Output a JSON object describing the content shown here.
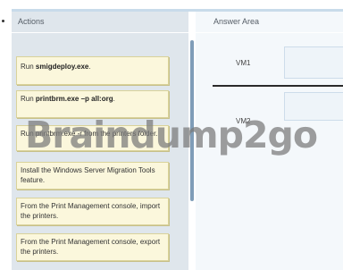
{
  "actions_panel": {
    "header": "Actions",
    "items": [
      {
        "prefix": "Run ",
        "bold": "smigdeploy.exe",
        "suffix": "."
      },
      {
        "prefix": "Run ",
        "bold": "printbrm.exe –p all:org",
        "suffix": "."
      },
      {
        "prefix": "",
        "bold": "",
        "suffix": "Run printbrm.exe -r from the printers folder."
      },
      {
        "prefix": "",
        "bold": "",
        "suffix": "Install the Windows Server Migration Tools feature."
      },
      {
        "prefix": "",
        "bold": "",
        "suffix": "From the Print Management console, import the printers."
      },
      {
        "prefix": "",
        "bold": "",
        "suffix": "From the Print Management console, export the printers."
      }
    ]
  },
  "answer_area": {
    "header": "Answer Area",
    "slots": [
      {
        "label": "VM1"
      },
      {
        "label": "VM2"
      }
    ]
  },
  "watermark": "Braindump2go"
}
